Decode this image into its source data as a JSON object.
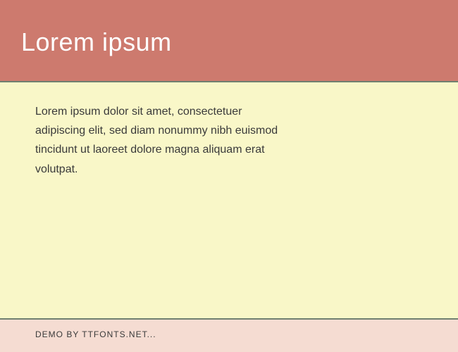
{
  "header": {
    "title": "Lorem ipsum"
  },
  "body": {
    "text": "Lorem ipsum dolor sit amet, consectetuer adipiscing elit, sed diam nonummy nibh euismod tincidunt ut laoreet dolore magna aliquam erat volutpat."
  },
  "footer": {
    "text": "DEMO BY TTFONTS.NET..."
  },
  "colors": {
    "header_bg": "#cd7a6e",
    "body_bg": "#f9f7c8",
    "footer_bg": "#f5dcd2",
    "divider": "#708070",
    "header_text": "#ffffff",
    "body_text": "#3a3a3a"
  }
}
